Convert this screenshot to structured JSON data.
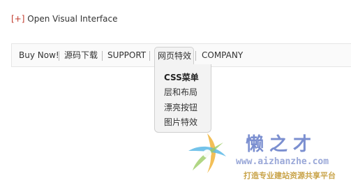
{
  "open_link": {
    "bracket": "[+]",
    "label": "Open Visual Interface"
  },
  "menu": {
    "items": [
      {
        "label": "Buy Now!"
      },
      {
        "label": "源码下载"
      },
      {
        "label": "SUPPORT"
      },
      {
        "label": "网页特效",
        "active": true
      },
      {
        "label": "COMPANY"
      }
    ]
  },
  "dropdown": {
    "items": [
      {
        "label": "CSS菜单",
        "bold": true
      },
      {
        "label": "层和布局"
      },
      {
        "label": "漂亮按钮"
      },
      {
        "label": "图片特效"
      }
    ]
  },
  "watermark": {
    "brand": "懒之才",
    "url": "www.aizhanzhe.com",
    "slogan": "打造专业建站资源共享平台",
    "colors": {
      "brand": "#7b8fd0",
      "slogan": "#c9a44a"
    }
  }
}
